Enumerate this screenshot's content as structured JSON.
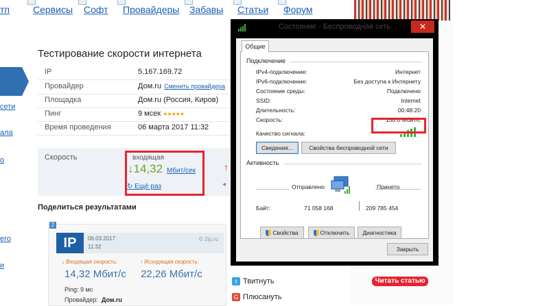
{
  "nav": {
    "items": [
      "Сервисы",
      "Софт",
      "Провайдеры",
      "Забавы",
      "Статьи",
      "Форум"
    ],
    "partial_left": "тп"
  },
  "page": {
    "title": "Тестирование скорости интернета",
    "left_links": [
      "сети",
      "ала",
      "о",
      "его",
      "и"
    ],
    "info": [
      {
        "key": "IP",
        "value": "5.167.169.72",
        "link": ""
      },
      {
        "key": "Провайдер",
        "value": "Дом.ru",
        "link": "Сменить провайдера"
      },
      {
        "key": "Площадка",
        "value": "Дом.ru (Россия, Киров)",
        "link": ""
      },
      {
        "key": "Пинг",
        "value": "9 мсек",
        "stars": "★★★★★",
        "link": ""
      },
      {
        "key": "Время проведения",
        "value": "06 марта 2017 11:32",
        "link": ""
      }
    ],
    "speed": {
      "label": "Скорость",
      "incoming_label": "входящая",
      "incoming_arrow": "↓",
      "incoming_value": "14,32",
      "incoming_unit": "Мбит/сек",
      "again": "Ещё раз"
    },
    "share_title": "Поделиться результатами",
    "card": {
      "badge": "2",
      "logo": "IP",
      "date": "06.03.2017",
      "time": "11:32",
      "brand": "© 2ip.ru",
      "in_label": "↓ Входящая скорость:",
      "out_label": "↑ Исходящая скорость:",
      "in_value": "14,32 Мбит/с",
      "out_value": "22,26 Мбит/с",
      "ping": "Ping: 9 мс",
      "provider_label": "Провайдер:",
      "provider_value": "Дом.ru"
    },
    "social": {
      "tweet": "Твитнуть",
      "plus": "Плюсануть"
    },
    "read_button": "Читать статью"
  },
  "dialog": {
    "title": "Состояние - Беспроводная сеть",
    "close": "✕",
    "tab": "Общие",
    "connection_group": "Подключение",
    "rows": [
      {
        "key": "IPv4-подключение:",
        "value": "Интернет"
      },
      {
        "key": "IPv6-подключение:",
        "value": "Без доступа к Интернету"
      },
      {
        "key": "Состояние среды:",
        "value": "Подключено"
      },
      {
        "key": "SSID:",
        "value": "Internet"
      },
      {
        "key": "Длительность:",
        "value": "00:48:20"
      },
      {
        "key": "Скорость:",
        "value": "150.0 Мбит/с"
      }
    ],
    "signal_label": "Качество сигнала:",
    "details_button": "Сведения...",
    "wireless_props_button": "Свойства беспроводной сети",
    "activity_group": "Активность",
    "sent_label": "Отправлено",
    "received_label": "Принято",
    "bytes_label": "Байт:",
    "bytes_sent": "71 058 168",
    "bytes_received": "209 785 454",
    "properties_button": "Свойства",
    "disable_button": "Отключить",
    "diagnose_button": "Диагностика",
    "footer_close_button": "Закрыть"
  },
  "colors": {
    "highlight": "#e8232e",
    "link": "#1a5fb4",
    "speed_green": "#6aa22b",
    "signal_green": "#3fae3a"
  }
}
